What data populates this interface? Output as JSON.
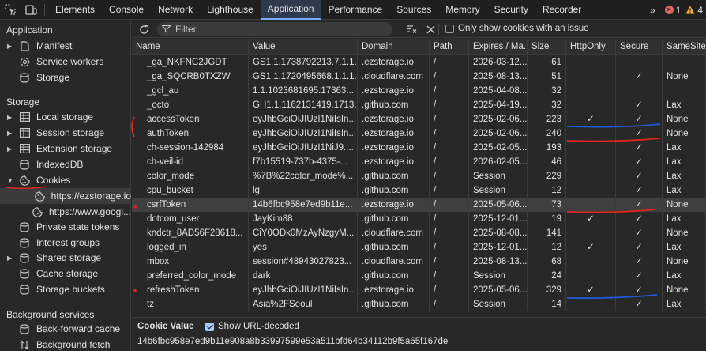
{
  "topbar": {
    "tabs": [
      "Elements",
      "Console",
      "Network",
      "Lighthouse",
      "Application",
      "Performance",
      "Sources",
      "Memory",
      "Security",
      "Recorder"
    ],
    "active_tab": "Application",
    "more_label": "»",
    "error_count": "1",
    "warning_count": "4"
  },
  "sidebar": {
    "application_title": "Application",
    "application_items": [
      "Manifest",
      "Service workers",
      "Storage"
    ],
    "storage_title": "Storage",
    "storage_items": [
      "Local storage",
      "Session storage",
      "Extension storage",
      "IndexedDB",
      "Cookies"
    ],
    "cookie_origins": [
      "https://ezstorage.io",
      "https://www.googl..."
    ],
    "more_storage_items": [
      "Private state tokens",
      "Interest groups",
      "Shared storage",
      "Cache storage",
      "Storage buckets"
    ],
    "background_title": "Background services",
    "background_items": [
      "Back-forward cache",
      "Background fetch"
    ]
  },
  "toolbar": {
    "filter_placeholder": "Filter",
    "only_issue_label": "Only show cookies with an issue"
  },
  "table": {
    "headers": [
      "Name",
      "Value",
      "Domain",
      "Path",
      "Expires / Ma...",
      "Size",
      "HttpOnly",
      "Secure",
      "SameSite"
    ],
    "rows": [
      [
        "_ga_NKFNC2JGDT",
        "GS1.1.1738792213.7.1.1...",
        ".ezstorage.io",
        "/",
        "2026-03-12...",
        "61",
        "",
        "",
        ""
      ],
      [
        "_ga_SQCRB0TXZW",
        "GS1.1.1720495668.1.1.1...",
        ".cloudflare.com",
        "/",
        "2025-08-13...",
        "51",
        "",
        "✓",
        "None"
      ],
      [
        "_gcl_au",
        "1.1.1023681695.17363...",
        ".ezstorage.io",
        "/",
        "2025-04-08...",
        "32",
        "",
        "",
        ""
      ],
      [
        "_octo",
        "GH1.1.1162131419.1713...",
        ".github.com",
        "/",
        "2025-04-19...",
        "32",
        "",
        "✓",
        "Lax"
      ],
      [
        "accessToken",
        "eyJhbGciOiJIUzI1NiIsIn...",
        ".ezstorage.io",
        "/",
        "2025-02-06...",
        "223",
        "✓",
        "✓",
        "None"
      ],
      [
        "authToken",
        "eyJhbGciOiJIUzI1NiIsIn...",
        ".ezstorage.io",
        "/",
        "2025-02-06...",
        "240",
        "",
        "✓",
        "None"
      ],
      [
        "ch-session-142984",
        "eyJhbGciOiJIUzI1NiJ9....",
        ".ezstorage.io",
        "/",
        "2025-02-05...",
        "193",
        "",
        "✓",
        "Lax"
      ],
      [
        "ch-veil-id",
        "f7b15519-737b-4375-...",
        ".ezstorage.io",
        "/",
        "2026-02-05...",
        "46",
        "",
        "✓",
        "Lax"
      ],
      [
        "color_mode",
        "%7B%22color_mode%...",
        ".github.com",
        "/",
        "Session",
        "229",
        "",
        "✓",
        "Lax"
      ],
      [
        "cpu_bucket",
        "lg",
        ".github.com",
        "/",
        "Session",
        "12",
        "",
        "✓",
        "Lax"
      ],
      [
        "csrfToken",
        "14b6fbc958e7ed9b11e...",
        ".ezstorage.io",
        "/",
        "2025-05-06...",
        "73",
        "",
        "✓",
        "None"
      ],
      [
        "dotcom_user",
        "JayKim88",
        ".github.com",
        "/",
        "2025-12-01...",
        "19",
        "✓",
        "✓",
        "Lax"
      ],
      [
        "kndctr_8AD56F28618...",
        "CiY0ODk0MzAyNzgyM...",
        ".cloudflare.com",
        "/",
        "2025-08-08...",
        "141",
        "",
        "✓",
        "None"
      ],
      [
        "logged_in",
        "yes",
        ".github.com",
        "/",
        "2025-12-01...",
        "12",
        "✓",
        "✓",
        "Lax"
      ],
      [
        "mbox",
        "session#48943027823...",
        ".cloudflare.com",
        "/",
        "2025-08-13...",
        "68",
        "",
        "✓",
        "None"
      ],
      [
        "preferred_color_mode",
        "dark",
        ".github.com",
        "/",
        "Session",
        "24",
        "",
        "✓",
        "Lax"
      ],
      [
        "refreshToken",
        "eyJhbGciOiJIUzI1NiIsIn...",
        ".ezstorage.io",
        "/",
        "2025-05-06...",
        "329",
        "✓",
        "✓",
        "None"
      ],
      [
        "tz",
        "Asia%2FSeoul",
        ".github.com",
        "/",
        "Session",
        "14",
        "",
        "✓",
        "Lax"
      ]
    ]
  },
  "cookie_value": {
    "title": "Cookie Value",
    "decode_label": "Show URL-decoded",
    "value": "14b6fbc958e7ed9b11e908a8b33997599e53a511bfd64b34112b9f5a65f167de"
  },
  "colors": {
    "accent": "#7cacf8",
    "annotation_red": "#e0261b",
    "annotation_blue": "#1e5bd6"
  }
}
